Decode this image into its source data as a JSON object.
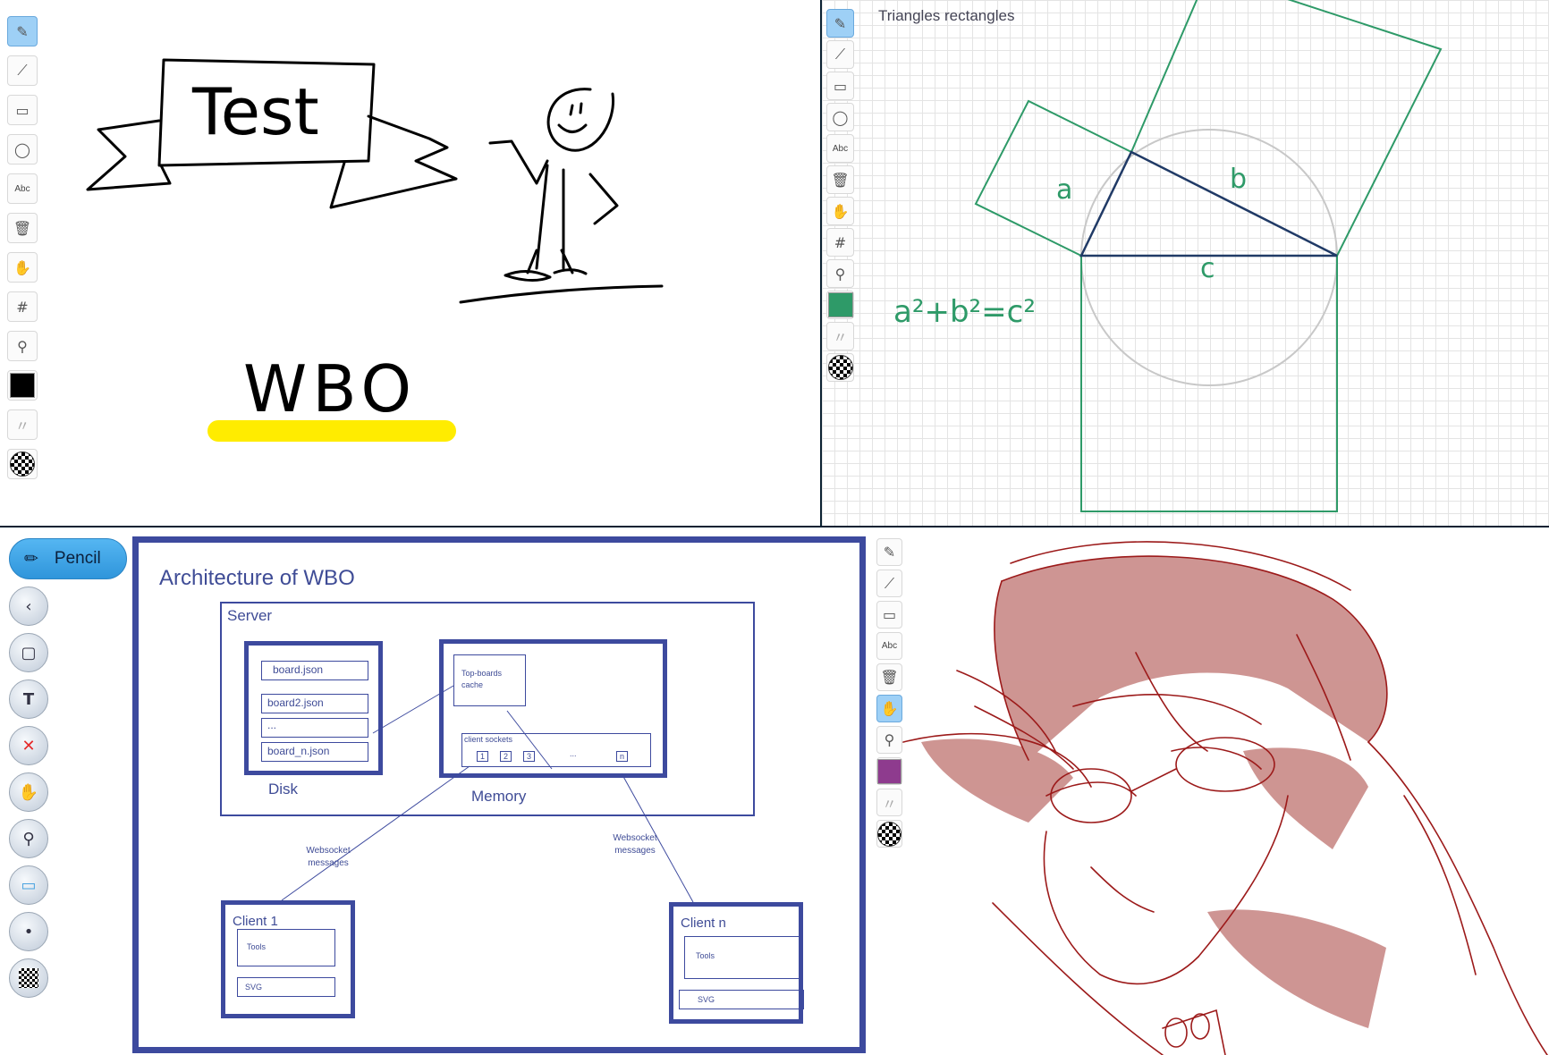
{
  "screens": {
    "sketch": {
      "tools": [
        {
          "name": "pencil",
          "icon": "pencil-icon",
          "glyph": "✎",
          "active": true
        },
        {
          "name": "line",
          "icon": "line-icon",
          "glyph": "⟋"
        },
        {
          "name": "rectangle",
          "icon": "rectangle-icon",
          "glyph": "▭"
        },
        {
          "name": "ellipse",
          "icon": "ellipse-icon",
          "glyph": "◯"
        },
        {
          "name": "text",
          "icon": "text-icon",
          "glyph": "Abc"
        },
        {
          "name": "eraser",
          "icon": "trash-icon",
          "glyph": "🗑"
        },
        {
          "name": "hand",
          "icon": "hand-icon",
          "glyph": "✋"
        },
        {
          "name": "grid",
          "icon": "grid-icon",
          "glyph": "#"
        },
        {
          "name": "zoom",
          "icon": "zoom-icon",
          "glyph": "⚲"
        }
      ],
      "color": "#000000",
      "banner_text": "Test",
      "wbo_text": "WBO",
      "highlight_color": "#ffec00"
    },
    "triangles": {
      "title": "Triangles rectangles",
      "labels": {
        "a": "a",
        "b": "b",
        "c": "c"
      },
      "formula_text": "a²+b²=c²",
      "color": "#2e9a68"
    },
    "architecture": {
      "pencil_label": "Pencil",
      "round_tools": [
        {
          "name": "back",
          "icon": "chevron-left-icon",
          "glyph": "‹"
        },
        {
          "name": "rectangle",
          "icon": "rectangle-icon",
          "glyph": "▢"
        },
        {
          "name": "text",
          "icon": "text-icon",
          "glyph": "T"
        },
        {
          "name": "eraser",
          "icon": "close-icon",
          "glyph": "✕"
        },
        {
          "name": "hand",
          "icon": "hand-icon",
          "glyph": "✋"
        },
        {
          "name": "zoom",
          "icon": "zoom-icon",
          "glyph": "🔍"
        },
        {
          "name": "board",
          "icon": "monitor-icon",
          "glyph": "▭"
        },
        {
          "name": "size",
          "icon": "dot-icon",
          "glyph": "•"
        },
        {
          "name": "opacity",
          "icon": "checker-icon",
          "glyph": ""
        }
      ],
      "diagram": {
        "title": "Architecture of WBO",
        "server": "Server",
        "disk": "Disk",
        "memory": "Memory",
        "files": [
          "board.json",
          "board2.json",
          "...",
          "board_n.json"
        ],
        "cache": "Top-boards cache",
        "client_sockets": "client sockets",
        "sockets": [
          "1",
          "2",
          "3",
          "...",
          "n"
        ],
        "websocket_left": "Websocket messages",
        "websocket_right": "Websocket messages",
        "client1": "Client 1",
        "clientn": "Client n",
        "tools": "Tools",
        "svg": "SVG"
      }
    },
    "drawing": {
      "tools": [
        {
          "name": "pencil",
          "icon": "pencil-icon",
          "glyph": "✎"
        },
        {
          "name": "line",
          "icon": "line-icon",
          "glyph": "⟋"
        },
        {
          "name": "rectangle",
          "icon": "rectangle-icon",
          "glyph": "▭"
        },
        {
          "name": "text",
          "icon": "text-icon",
          "glyph": "Abc"
        },
        {
          "name": "eraser",
          "icon": "trash-icon",
          "glyph": "🗑"
        },
        {
          "name": "hand",
          "icon": "hand-icon",
          "glyph": "✋",
          "active": true
        },
        {
          "name": "zoom",
          "icon": "zoom-icon",
          "glyph": "⚲"
        }
      ],
      "color": "#8e3b8e",
      "stroke_color": "#9c1a1a",
      "fill_color": "#c98a87"
    }
  }
}
